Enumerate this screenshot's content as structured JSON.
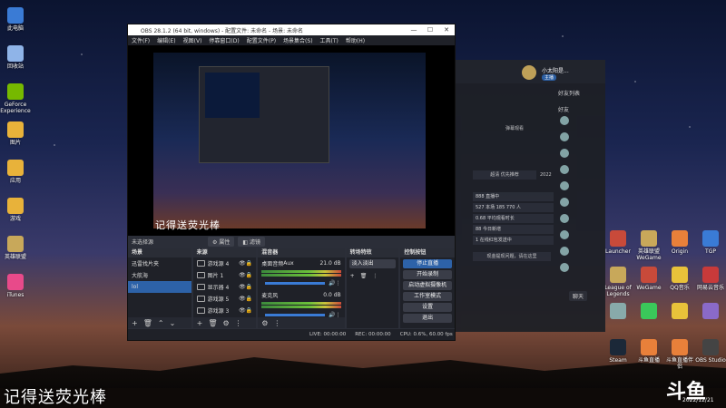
{
  "desktop": {
    "icons": [
      {
        "label": "此电脑",
        "color": "#3a7bd5"
      },
      {
        "label": "回收站",
        "color": "#8fb4e8"
      },
      {
        "label": "GeForce Experience",
        "color": "#76b900"
      },
      {
        "label": "图片",
        "color": "#e8b23a"
      },
      {
        "label": "应用",
        "color": "#e8b23a"
      },
      {
        "label": "游戏",
        "color": "#e8b23a"
      },
      {
        "label": "英雄联盟",
        "color": "#c8a85a"
      },
      {
        "label": "iTunes",
        "color": "#e84a8a"
      }
    ],
    "right_icons_row1": [
      {
        "label": "Launcher",
        "color": "#c84a3a"
      },
      {
        "label": "英雄联盟WeGame",
        "color": "#c8a85a"
      },
      {
        "label": "Origin",
        "color": "#e8803a"
      },
      {
        "label": "TGP",
        "color": "#3a7bd5"
      }
    ],
    "right_icons_row2": [
      {
        "label": "League of Legends",
        "color": "#c8a85a"
      },
      {
        "label": "WeGame",
        "color": "#c84a3a"
      },
      {
        "label": "QQ音乐",
        "color": "#e8c23a"
      },
      {
        "label": "网易云音乐",
        "color": "#c83a3a"
      }
    ],
    "right_icons_row3": [
      {
        "label": "",
        "color": "#8aa"
      },
      {
        "label": "",
        "color": "#3ac85a"
      },
      {
        "label": "",
        "color": "#e8c23a"
      },
      {
        "label": "",
        "color": "#8a6ac8"
      }
    ],
    "right_icons_row4": [
      {
        "label": "Steam",
        "color": "#1b2838"
      },
      {
        "label": "斗鱼直播",
        "color": "#e8803a"
      },
      {
        "label": "斗鱼直播伴侣",
        "color": "#e8803a"
      },
      {
        "label": "OBS Studio",
        "color": "#444"
      }
    ]
  },
  "obs": {
    "title": "OBS 28.1.2 (64 bit, windows) - 配置文件: 未命名 - 场景: 未命名",
    "menu": [
      "文件(F)",
      "编辑(E)",
      "视图(V)",
      "停靠窗口(D)",
      "配置文件(P)",
      "场景集合(S)",
      "工具(T)",
      "帮助(H)"
    ],
    "preview_watermark": "记得送荧光棒",
    "scene_bar": {
      "label": "未选择源",
      "props": "属性",
      "filters": "滤镜"
    },
    "scenes": {
      "title": "场景",
      "items": [
        "迅雷找片夹",
        "大航海",
        "lol"
      ],
      "selected": 2
    },
    "sources": {
      "title": "来源",
      "items": [
        "游戏源 4",
        "图片 1",
        "显示器 4",
        "游戏源 5",
        "游戏源 3",
        "进入器?"
      ]
    },
    "mixer": {
      "title": "混音器",
      "channels": [
        {
          "name": "桌面音频",
          "sub": "Aux",
          "db": "21.0 dB"
        },
        {
          "name": "麦克风",
          "sub": "",
          "db": "0.0 dB"
        }
      ]
    },
    "transitions": {
      "title": "转场特效",
      "selected": "淡入淡出"
    },
    "controls": {
      "title": "控制按钮",
      "buttons": [
        "停止直播",
        "开始录制",
        "启动虚拟摄像机",
        "工作室模式",
        "设置",
        "退出"
      ]
    },
    "status": {
      "live": "LIVE: 00:00:00",
      "rec": "REC: 00:00:00",
      "cpu": "CPU: 0.6%, 60.00 fps"
    }
  },
  "douyu": {
    "user_name": "小太阳是...",
    "user_tag": "主播",
    "friends_header": "好友列表",
    "friends_sub": "好友",
    "stats": [
      "888  直播中",
      "527  本场  185  770  人",
      "0.68  平均观看时长",
      "88  今日新增",
      "1  在线红包发送中"
    ],
    "chip": "超清 优先推荐",
    "label_1": "弹幕观看",
    "label_2": "2022",
    "chat_btn": "聊天",
    "link_text": "现金提现问题，请在这里"
  },
  "overlay": {
    "watermark": "记得送荧光棒",
    "logo": "斗鱼",
    "date": "2022/12/21"
  }
}
